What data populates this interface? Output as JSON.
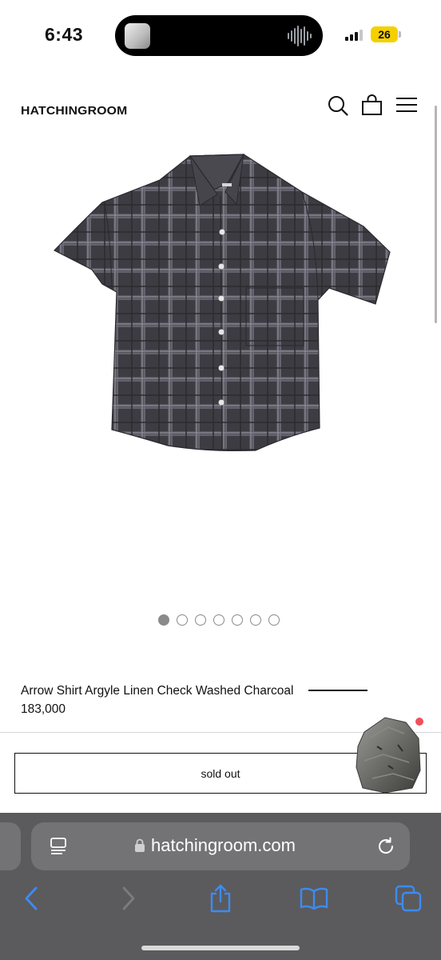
{
  "status_bar": {
    "time": "6:43",
    "battery": "26",
    "battery_color": "#f5d000",
    "signal_icon": "cellular-signal-icon",
    "island_icons": [
      "media-thumbnail",
      "audio-waveform-icon"
    ]
  },
  "site": {
    "logo": "HATCHINGROOM",
    "icons": [
      "search-icon",
      "shopping-bag-icon",
      "hamburger-menu-icon"
    ]
  },
  "carousel": {
    "image": "charcoal-check-linen-shirt",
    "total": 7,
    "active": 1
  },
  "product": {
    "name": "Arrow Shirt Argyle Linen Check Washed Charcoal",
    "price": "183,000",
    "button_label": "sold out"
  },
  "floating_widget": {
    "image": "rock-icon",
    "badge_color": "#f0505a"
  },
  "browser": {
    "url": "hatchingroom.com",
    "url_icons": [
      "reader-icon",
      "lock-icon",
      "reload-icon"
    ],
    "toolbar": [
      "back-icon",
      "forward-icon",
      "share-icon",
      "bookmarks-icon",
      "tabs-icon"
    ],
    "accent": "#3d8bf2"
  }
}
